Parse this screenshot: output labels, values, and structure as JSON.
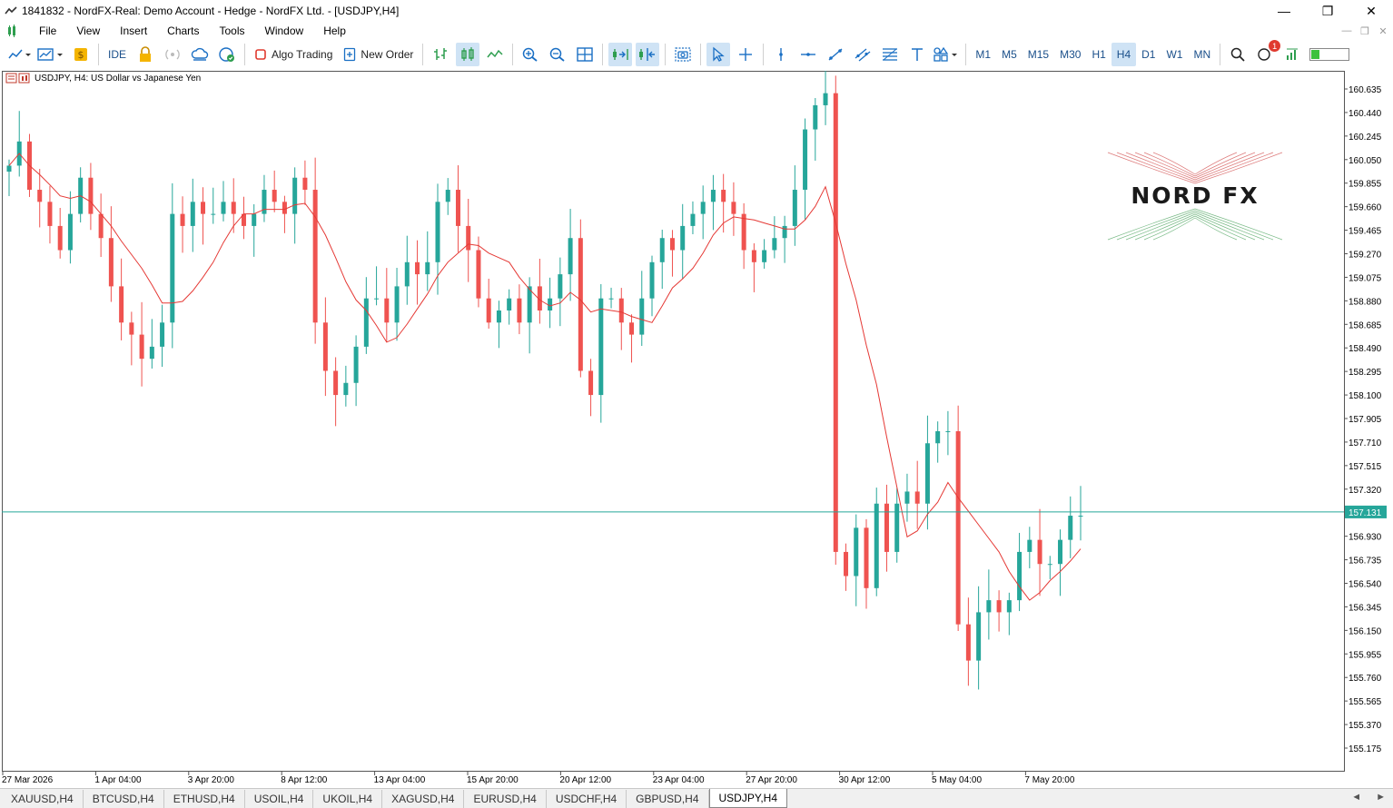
{
  "window": {
    "title": "1841832 - NordFX-Real: Demo Account - Hedge - NordFX Ltd. - [USDJPY,H4]",
    "minimize": "—",
    "restore": "❐",
    "close": "✕"
  },
  "menu": {
    "items": [
      "File",
      "View",
      "Insert",
      "Charts",
      "Tools",
      "Window",
      "Help"
    ]
  },
  "toolbar": {
    "ide_label": "IDE",
    "algo_label": "Algo Trading",
    "new_order_label": "New Order",
    "timeframes": [
      "M1",
      "M5",
      "M15",
      "M30",
      "H1",
      "H4",
      "D1",
      "W1",
      "MN"
    ],
    "active_timeframe": "H4",
    "notification_count": "1",
    "connection_level": 0.2
  },
  "chart": {
    "symbol_label": "USDJPY, H4:  US Dollar vs Japanese Yen",
    "current_price": "157.131",
    "logo_text": "NORD FX",
    "colors": {
      "bull": "#26a69a",
      "bear": "#ef5350",
      "ma": "#e53935",
      "bid_line": "#26a69a",
      "axis_text": "#000000"
    }
  },
  "chart_data": {
    "type": "candlestick",
    "symbol": "USDJPY",
    "timeframe": "H4",
    "price_ticks": [
      160.635,
      160.44,
      160.245,
      160.05,
      159.855,
      159.66,
      159.465,
      159.27,
      159.075,
      158.88,
      158.685,
      158.49,
      158.295,
      158.1,
      157.905,
      157.71,
      157.515,
      157.32,
      157.131,
      156.93,
      156.735,
      156.54,
      156.345,
      156.15,
      155.955,
      155.76,
      155.565,
      155.37,
      155.175
    ],
    "price_tick_labels": [
      "160.635",
      "160.440",
      "160.245",
      "160.050",
      "159.855",
      "159.660",
      "159.465",
      "159.270",
      "159.075",
      "158.880",
      "158.685",
      "158.490",
      "158.295",
      "158.100",
      "157.905",
      "157.710",
      "157.515",
      "157.320",
      "157.131",
      "156.930",
      "156.735",
      "156.540",
      "156.345",
      "156.150",
      "155.955",
      "155.760",
      "155.565",
      "155.370",
      "155.175"
    ],
    "ylim": [
      155.05,
      160.72
    ],
    "time_labels": [
      "27 Mar 2026",
      "1 Apr 04:00",
      "3 Apr 20:00",
      "8 Apr 12:00",
      "13 Apr 04:00",
      "15 Apr 20:00",
      "20 Apr 12:00",
      "23 Apr 04:00",
      "27 Apr 20:00",
      "30 Apr 12:00",
      "5 May 04:00",
      "7 May 20:00"
    ],
    "candles_close": [
      160.0,
      160.2,
      159.8,
      159.7,
      159.5,
      159.3,
      159.6,
      159.9,
      159.6,
      159.4,
      159.0,
      158.7,
      158.6,
      158.4,
      158.5,
      158.7,
      159.6,
      159.5,
      159.7,
      159.6,
      159.6,
      159.7,
      159.6,
      159.5,
      159.6,
      159.8,
      159.7,
      159.6,
      159.9,
      159.8,
      158.7,
      158.3,
      158.1,
      158.2,
      158.5,
      158.9,
      158.9,
      158.7,
      159.0,
      159.2,
      159.1,
      159.2,
      159.7,
      159.8,
      159.5,
      159.3,
      158.9,
      158.7,
      158.8,
      158.9,
      158.7,
      159.0,
      158.8,
      158.9,
      159.1,
      159.4,
      158.3,
      158.1,
      158.9,
      158.9,
      158.7,
      158.6,
      158.9,
      159.2,
      159.4,
      159.3,
      159.5,
      159.6,
      159.7,
      159.8,
      159.7,
      159.6,
      159.3,
      159.2,
      159.3,
      159.4,
      159.5,
      159.8,
      160.3,
      160.5,
      160.6,
      156.8,
      156.6,
      157.0,
      156.5,
      157.2,
      156.8,
      157.2,
      157.3,
      157.2,
      157.7,
      157.8,
      157.8,
      156.2,
      155.9,
      156.3,
      156.4,
      156.3,
      156.4,
      156.8,
      156.9,
      156.7,
      156.7,
      156.9,
      157.1,
      157.1
    ],
    "ma_period_visible": true,
    "bid_price": 157.131,
    "grid": false
  },
  "tabs": {
    "items": [
      "XAUUSD,H4",
      "BTCUSD,H4",
      "ETHUSD,H4",
      "USOIL,H4",
      "UKOIL,H4",
      "XAGUSD,H4",
      "EURUSD,H4",
      "USDCHF,H4",
      "GBPUSD,H4",
      "USDJPY,H4"
    ],
    "active": "USDJPY,H4",
    "scroll_left": "◄",
    "scroll_right": "►"
  }
}
